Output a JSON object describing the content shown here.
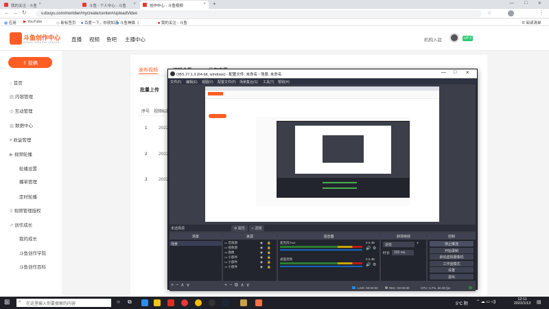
{
  "browser": {
    "tabs": [
      {
        "label": "我的关注 - 斗鱼"
      },
      {
        "label": "斗鱼 - 个人中心 - 斗鱼"
      },
      {
        "label": "创作中心 - 斗鱼视频"
      }
    ],
    "url": "v.douyu.com/member/mycreate/center#/uploadVideo",
    "bookmarks": [
      "应用",
      "YouTube",
      "新标签页",
      "百度一下，你就知道",
      "斗鱼神猫（",
      "我的关注 - 斗鱼"
    ],
    "reading_list": "阅读清单"
  },
  "site": {
    "logo": "斗鱼创作中心",
    "logo_sub": "DOUYU CREATIVE CENTER",
    "nav": [
      "直播",
      "视频",
      "鱼吧",
      "主播中心"
    ],
    "user": "机构入驻",
    "level": "UP 3",
    "sidebar": {
      "upload_button": "投稿",
      "items": [
        {
          "label": "首页",
          "sub": false
        },
        {
          "label": "内容管理",
          "sub": false
        },
        {
          "label": "互动管理",
          "sub": false
        },
        {
          "label": "数据中心",
          "sub": false
        },
        {
          "label": "收益管理",
          "sub": false
        },
        {
          "label": "视频轮播",
          "sub": false
        },
        {
          "label": "轮播设置",
          "sub": true
        },
        {
          "label": "播单管理",
          "sub": true
        },
        {
          "label": "定时轮播",
          "sub": true
        },
        {
          "label": "视频管理授权",
          "sub": false
        },
        {
          "label": "创作成长",
          "sub": false
        },
        {
          "label": "我的成长",
          "sub": true
        },
        {
          "label": "斗鱼创作学院",
          "sub": true
        },
        {
          "label": "斗鱼创作百科",
          "sub": true
        }
      ]
    },
    "content": {
      "tabs": [
        "发布视频",
        "编辑合集",
        "发布文章"
      ],
      "batch_upload": "批量上传",
      "columns": [
        "序号",
        "视频标题"
      ],
      "rows": [
        {
          "no": "1",
          "date": "2022"
        },
        {
          "no": "2",
          "date": "2022"
        },
        {
          "no": "3",
          "date": "2022"
        }
      ]
    }
  },
  "obs": {
    "title": "OBS 27.1.3 (64-bit, windows) - 配置文件: 未命名 - 场景: 未命名",
    "menu": [
      "文件(F)",
      "编辑(E)",
      "视图(V)",
      "配置文件(P)",
      "场景集合(S)",
      "工具(T)",
      "帮助(H)"
    ],
    "no_source": "未选择源",
    "props_button": "属性",
    "filters_button": "滤镜",
    "docks": {
      "scenes": "场景",
      "sources": "来源",
      "mixer": "混音器",
      "transitions": "转场特效",
      "controls": "控制"
    },
    "scene_items": [
      "场景"
    ],
    "source_items": [
      "音频源",
      "视频源",
      "图像",
      "小部件",
      "小部件",
      "小部件"
    ],
    "mixer": [
      {
        "name": "麦克风/Aux",
        "db": "0.0 dB"
      },
      {
        "name": "桌面音频",
        "db": "0.0 dB"
      }
    ],
    "transition": {
      "value": "渐变",
      "duration_label": "时长",
      "duration": "300 ms"
    },
    "controls": [
      "停止推流",
      "开始录制",
      "启动虚拟摄像机",
      "工作室模式",
      "设置",
      "退出"
    ],
    "status": {
      "live": "LIVE: 00:00:00",
      "rec": "REC: 00:00:00",
      "cpu": "CPU: 3.7%, 60.00 fps"
    }
  },
  "taskbar": {
    "search_placeholder": "在这里输入你要搜索的内容",
    "weather": "5°C 阴",
    "time": "12:11",
    "date": "2022/1/13"
  }
}
